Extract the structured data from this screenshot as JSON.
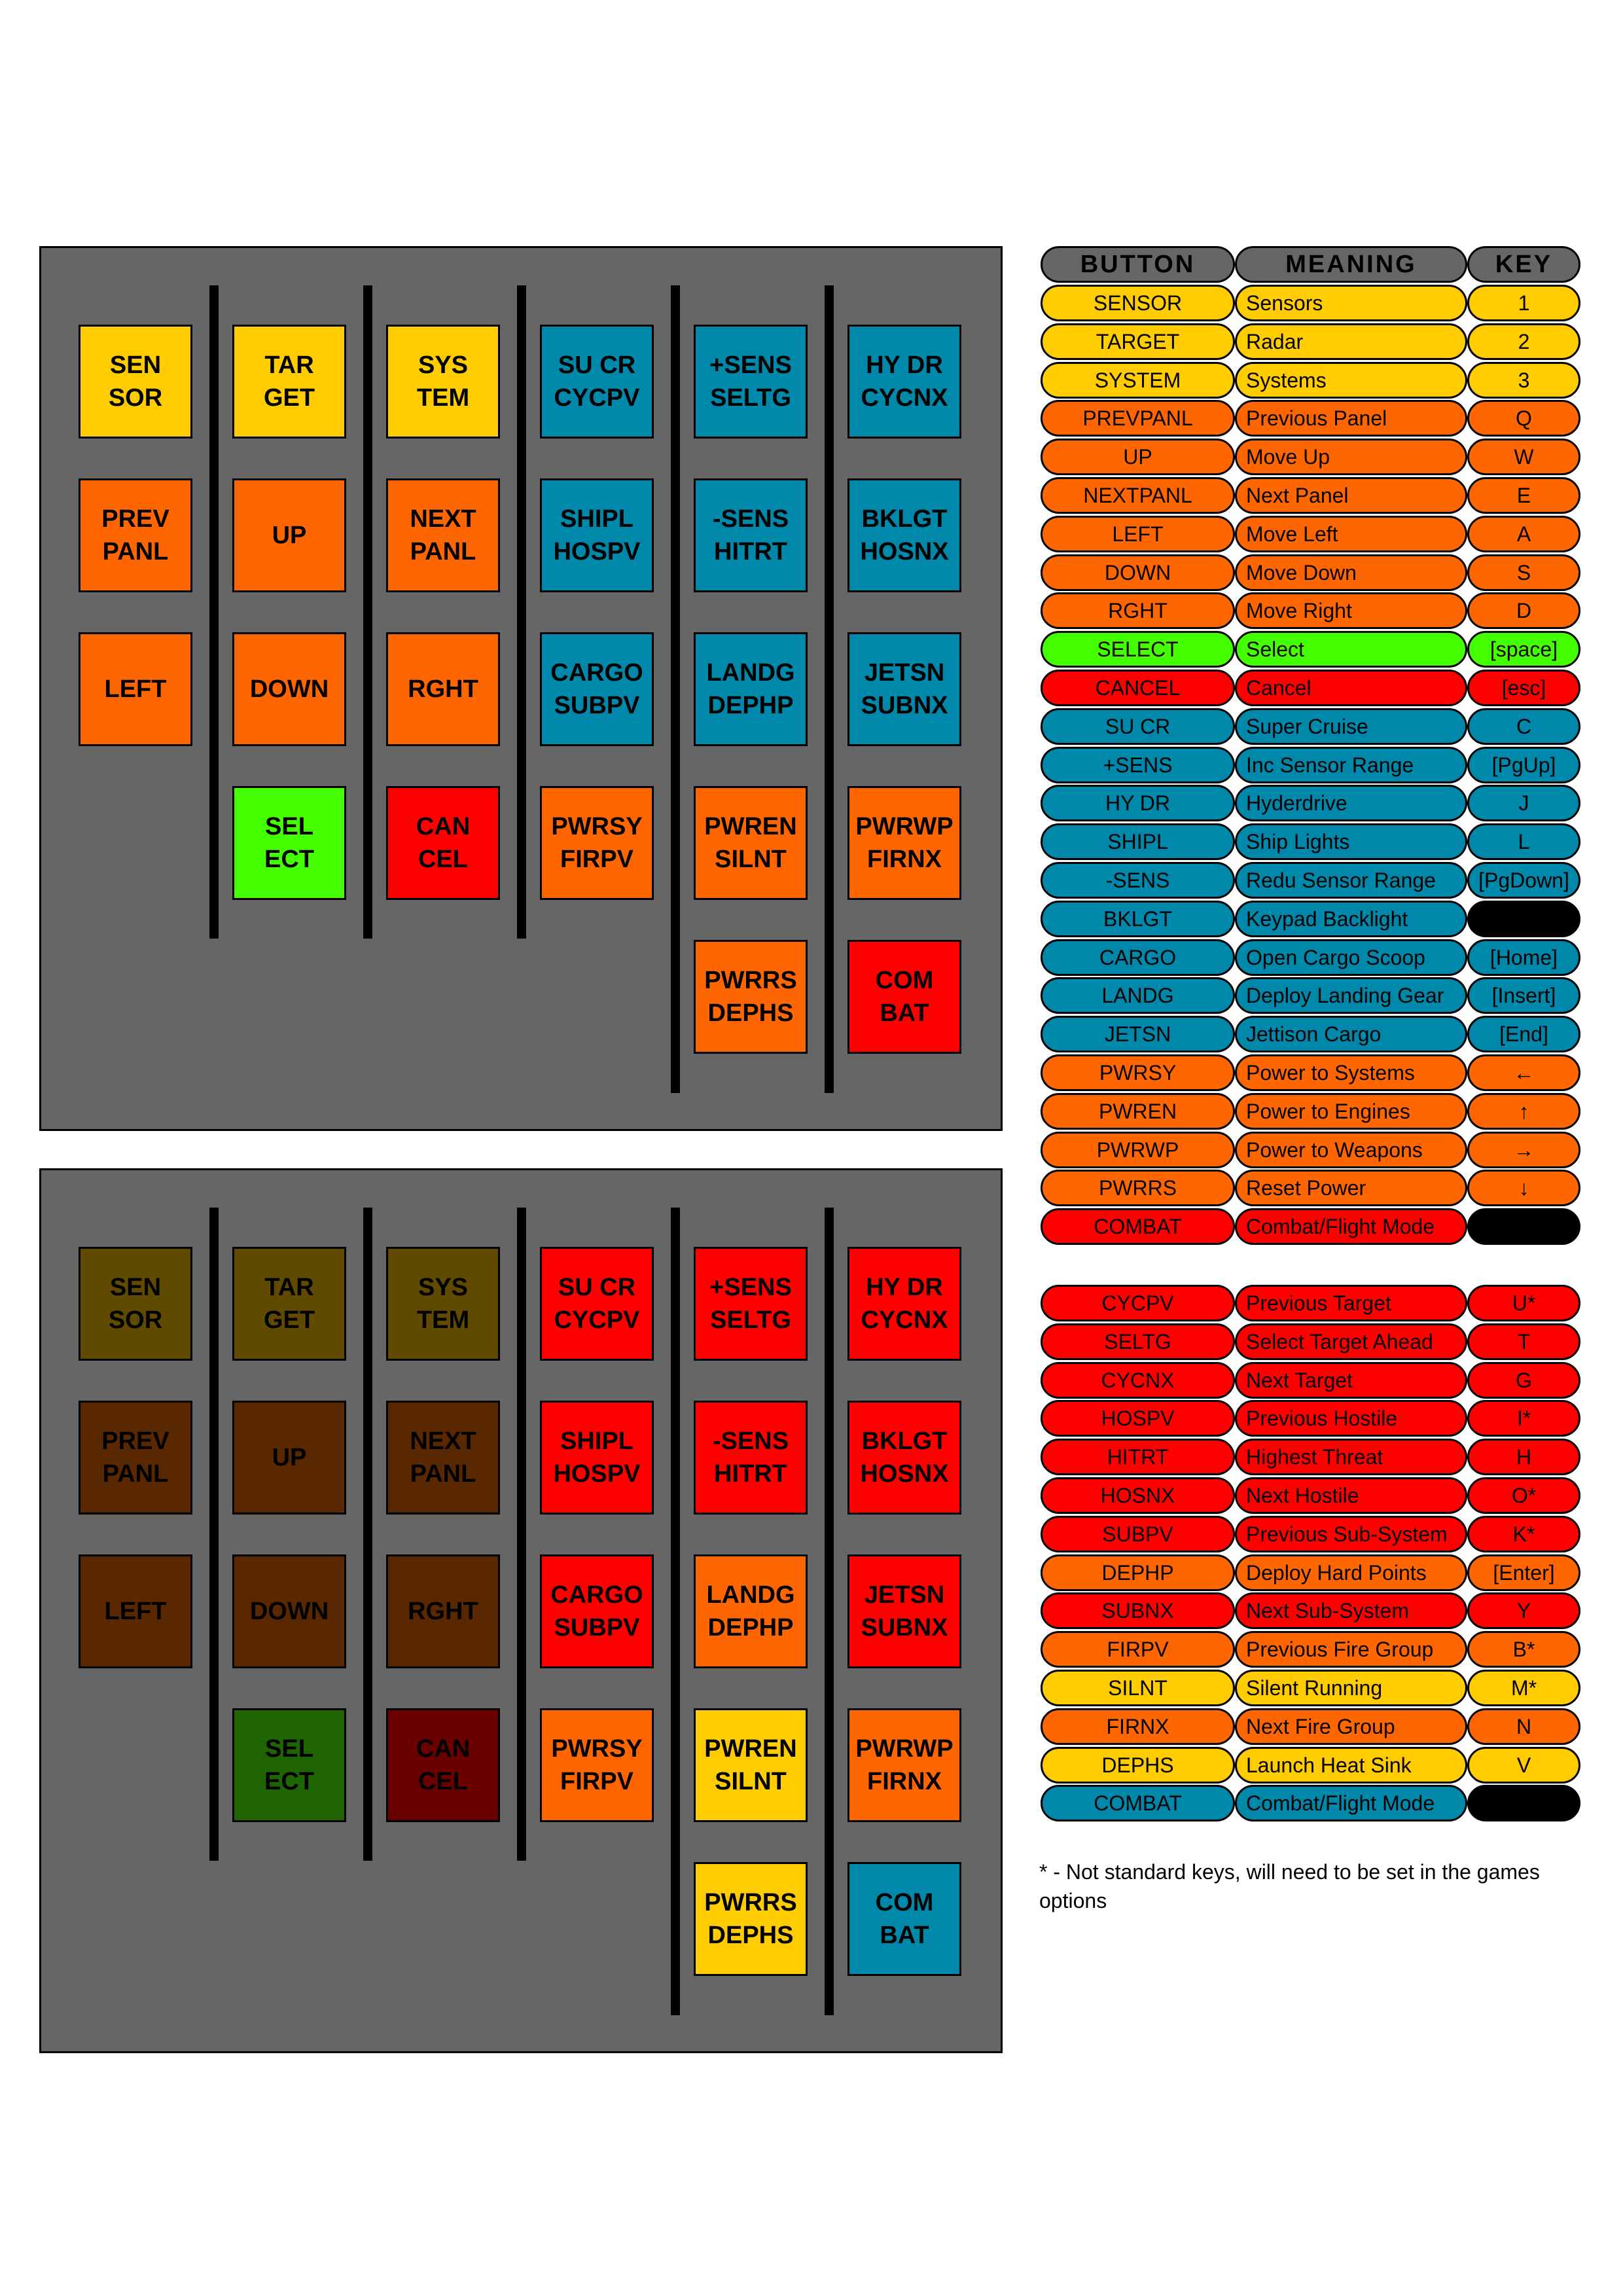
{
  "colors": {
    "panel_bg": "#666666",
    "yellow": "#FFCC00",
    "orange": "#FF6600",
    "blue": "#0088AA",
    "green": "#44FF00",
    "red": "#FF0000",
    "dark_yellow": "#5F4A00",
    "dark_brown": "#5A2800",
    "dark_green": "#1E6400",
    "dark_red": "#6A0000",
    "header_gray": "#666666",
    "black": "#000000"
  },
  "panels": [
    {
      "keys": [
        {
          "lines": [
            "SEN",
            "SOR"
          ],
          "color": "#FFCC00"
        },
        {
          "lines": [
            "TAR",
            "GET"
          ],
          "color": "#FFCC00"
        },
        {
          "lines": [
            "SYS",
            "TEM"
          ],
          "color": "#FFCC00"
        },
        {
          "lines": [
            "SU CR",
            "CYCPV"
          ],
          "color": "#0088AA"
        },
        {
          "lines": [
            "+SENS",
            "SELTG"
          ],
          "color": "#0088AA"
        },
        {
          "lines": [
            "HY DR",
            "CYCNX"
          ],
          "color": "#0088AA"
        },
        {
          "lines": [
            "PREV",
            "PANL"
          ],
          "color": "#FF6600"
        },
        {
          "lines": [
            "UP"
          ],
          "color": "#FF6600"
        },
        {
          "lines": [
            "NEXT",
            "PANL"
          ],
          "color": "#FF6600"
        },
        {
          "lines": [
            "SHIPL",
            "HOSPV"
          ],
          "color": "#0088AA"
        },
        {
          "lines": [
            "-SENS",
            "HITRT"
          ],
          "color": "#0088AA"
        },
        {
          "lines": [
            "BKLGT",
            "HOSNX"
          ],
          "color": "#0088AA"
        },
        {
          "lines": [
            "LEFT"
          ],
          "color": "#FF6600"
        },
        {
          "lines": [
            "DOWN"
          ],
          "color": "#FF6600"
        },
        {
          "lines": [
            "RGHT"
          ],
          "color": "#FF6600"
        },
        {
          "lines": [
            "CARGO",
            "SUBPV"
          ],
          "color": "#0088AA"
        },
        {
          "lines": [
            "LANDG",
            "DEPHP"
          ],
          "color": "#0088AA"
        },
        {
          "lines": [
            "JETSN",
            "SUBNX"
          ],
          "color": "#0088AA"
        },
        {
          "lines": [
            "SEL",
            "ECT"
          ],
          "color": "#44FF00"
        },
        {
          "lines": [
            "CAN",
            "CEL"
          ],
          "color": "#FF0000"
        },
        {
          "lines": [
            "PWRSY",
            "FIRPV"
          ],
          "color": "#FF6600"
        },
        {
          "lines": [
            "PWREN",
            "SILNT"
          ],
          "color": "#FF6600"
        },
        {
          "lines": [
            "PWRWP",
            "FIRNX"
          ],
          "color": "#FF6600"
        },
        {
          "lines": [
            "PWRRS",
            "DEPHS"
          ],
          "color": "#FF6600"
        },
        {
          "lines": [
            "COM",
            "BAT"
          ],
          "color": "#FF0000"
        }
      ]
    },
    {
      "keys": [
        {
          "lines": [
            "SEN",
            "SOR"
          ],
          "color": "#5F4A00"
        },
        {
          "lines": [
            "TAR",
            "GET"
          ],
          "color": "#5F4A00"
        },
        {
          "lines": [
            "SYS",
            "TEM"
          ],
          "color": "#5F4A00"
        },
        {
          "lines": [
            "SU CR",
            "CYCPV"
          ],
          "color": "#FF0000"
        },
        {
          "lines": [
            "+SENS",
            "SELTG"
          ],
          "color": "#FF0000"
        },
        {
          "lines": [
            "HY DR",
            "CYCNX"
          ],
          "color": "#FF0000"
        },
        {
          "lines": [
            "PREV",
            "PANL"
          ],
          "color": "#5A2800"
        },
        {
          "lines": [
            "UP"
          ],
          "color": "#5A2800"
        },
        {
          "lines": [
            "NEXT",
            "PANL"
          ],
          "color": "#5A2800"
        },
        {
          "lines": [
            "SHIPL",
            "HOSPV"
          ],
          "color": "#FF0000"
        },
        {
          "lines": [
            "-SENS",
            "HITRT"
          ],
          "color": "#FF0000"
        },
        {
          "lines": [
            "BKLGT",
            "HOSNX"
          ],
          "color": "#FF0000"
        },
        {
          "lines": [
            "LEFT"
          ],
          "color": "#5A2800"
        },
        {
          "lines": [
            "DOWN"
          ],
          "color": "#5A2800"
        },
        {
          "lines": [
            "RGHT"
          ],
          "color": "#5A2800"
        },
        {
          "lines": [
            "CARGO",
            "SUBPV"
          ],
          "color": "#FF0000"
        },
        {
          "lines": [
            "LANDG",
            "DEPHP"
          ],
          "color": "#FF6600"
        },
        {
          "lines": [
            "JETSN",
            "SUBNX"
          ],
          "color": "#FF0000"
        },
        {
          "lines": [
            "SEL",
            "ECT"
          ],
          "color": "#1E6400"
        },
        {
          "lines": [
            "CAN",
            "CEL"
          ],
          "color": "#6A0000"
        },
        {
          "lines": [
            "PWRSY",
            "FIRPV"
          ],
          "color": "#FF6600"
        },
        {
          "lines": [
            "PWREN",
            "SILNT"
          ],
          "color": "#FFCC00"
        },
        {
          "lines": [
            "PWRWP",
            "FIRNX"
          ],
          "color": "#FF6600"
        },
        {
          "lines": [
            "PWRRS",
            "DEPHS"
          ],
          "color": "#FFCC00"
        },
        {
          "lines": [
            "COM",
            "BAT"
          ],
          "color": "#0088AA"
        }
      ]
    }
  ],
  "legend_header": {
    "button": "BUTTON",
    "meaning": "MEANING",
    "key": "KEY"
  },
  "legend1": [
    {
      "button": "SENSOR",
      "meaning": "Sensors",
      "key": "1",
      "color": "#FFCC00"
    },
    {
      "button": "TARGET",
      "meaning": "Radar",
      "key": "2",
      "color": "#FFCC00"
    },
    {
      "button": "SYSTEM",
      "meaning": "Systems",
      "key": "3",
      "color": "#FFCC00"
    },
    {
      "button": "PREVPANL",
      "meaning": "Previous Panel",
      "key": "Q",
      "color": "#FF6600"
    },
    {
      "button": "UP",
      "meaning": "Move Up",
      "key": "W",
      "color": "#FF6600"
    },
    {
      "button": "NEXTPANL",
      "meaning": "Next Panel",
      "key": "E",
      "color": "#FF6600"
    },
    {
      "button": "LEFT",
      "meaning": "Move Left",
      "key": "A",
      "color": "#FF6600"
    },
    {
      "button": "DOWN",
      "meaning": "Move Down",
      "key": "S",
      "color": "#FF6600"
    },
    {
      "button": "RGHT",
      "meaning": "Move Right",
      "key": "D",
      "color": "#FF6600"
    },
    {
      "button": "SELECT",
      "meaning": "Select",
      "key": "[space]",
      "color": "#44FF00"
    },
    {
      "button": "CANCEL",
      "meaning": "Cancel",
      "key": "[esc]",
      "color": "#FF0000"
    },
    {
      "button": "SU CR",
      "meaning": "Super Cruise",
      "key": "C",
      "color": "#0088AA"
    },
    {
      "button": "+SENS",
      "meaning": "Inc Sensor Range",
      "key": "[PgUp]",
      "color": "#0088AA"
    },
    {
      "button": "HY DR",
      "meaning": "Hyderdrive",
      "key": "J",
      "color": "#0088AA"
    },
    {
      "button": "SHIPL",
      "meaning": "Ship Lights",
      "key": "L",
      "color": "#0088AA"
    },
    {
      "button": "-SENS",
      "meaning": "Redu Sensor Range",
      "key": "[PgDown]",
      "color": "#0088AA"
    },
    {
      "button": "BKLGT",
      "meaning": "Keypad Backlight",
      "key": "",
      "color": "#0088AA",
      "key_color": "#000000"
    },
    {
      "button": "CARGO",
      "meaning": "Open Cargo Scoop",
      "key": "[Home]",
      "color": "#0088AA"
    },
    {
      "button": "LANDG",
      "meaning": "Deploy Landing Gear",
      "key": "[Insert]",
      "color": "#0088AA"
    },
    {
      "button": "JETSN",
      "meaning": "Jettison Cargo",
      "key": "[End]",
      "color": "#0088AA"
    },
    {
      "button": "PWRSY",
      "meaning": "Power to Systems",
      "key": "←",
      "color": "#FF6600"
    },
    {
      "button": "PWREN",
      "meaning": "Power to Engines",
      "key": "↑",
      "color": "#FF6600"
    },
    {
      "button": "PWRWP",
      "meaning": "Power to Weapons",
      "key": "→",
      "color": "#FF6600"
    },
    {
      "button": "PWRRS",
      "meaning": "Reset Power",
      "key": "↓",
      "color": "#FF6600"
    },
    {
      "button": "COMBAT",
      "meaning": "Combat/Flight Mode",
      "key": "",
      "color": "#FF0000",
      "key_color": "#000000"
    }
  ],
  "legend2": [
    {
      "button": "CYCPV",
      "meaning": "Previous Target",
      "key": "U*",
      "color": "#FF0000"
    },
    {
      "button": "SELTG",
      "meaning": "Select Target Ahead",
      "key": "T",
      "color": "#FF0000"
    },
    {
      "button": "CYCNX",
      "meaning": "Next Target",
      "key": "G",
      "color": "#FF0000"
    },
    {
      "button": "HOSPV",
      "meaning": "Previous Hostile",
      "key": "I*",
      "color": "#FF0000"
    },
    {
      "button": "HITRT",
      "meaning": "Highest Threat",
      "key": "H",
      "color": "#FF0000"
    },
    {
      "button": "HOSNX",
      "meaning": "Next Hostile",
      "key": "O*",
      "color": "#FF0000"
    },
    {
      "button": "SUBPV",
      "meaning": "Previous Sub-System",
      "key": "K*",
      "color": "#FF0000"
    },
    {
      "button": "DEPHP",
      "meaning": "Deploy Hard Points",
      "key": "[Enter]",
      "color": "#FF6600"
    },
    {
      "button": "SUBNX",
      "meaning": "Next Sub-System",
      "key": "Y",
      "color": "#FF0000"
    },
    {
      "button": "FIRPV",
      "meaning": "Previous Fire Group",
      "key": "B*",
      "color": "#FF6600"
    },
    {
      "button": "SILNT",
      "meaning": "Silent Running",
      "key": "M*",
      "color": "#FFCC00"
    },
    {
      "button": "FIRNX",
      "meaning": "Next Fire Group",
      "key": "N",
      "color": "#FF6600"
    },
    {
      "button": "DEPHS",
      "meaning": "Launch Heat Sink",
      "key": "V",
      "color": "#FFCC00"
    },
    {
      "button": "COMBAT",
      "meaning": "Combat/Flight Mode",
      "key": "",
      "color": "#0088AA",
      "key_color": "#000000"
    }
  ],
  "footnote": "* - Not standard keys, will need to be set in the games options"
}
